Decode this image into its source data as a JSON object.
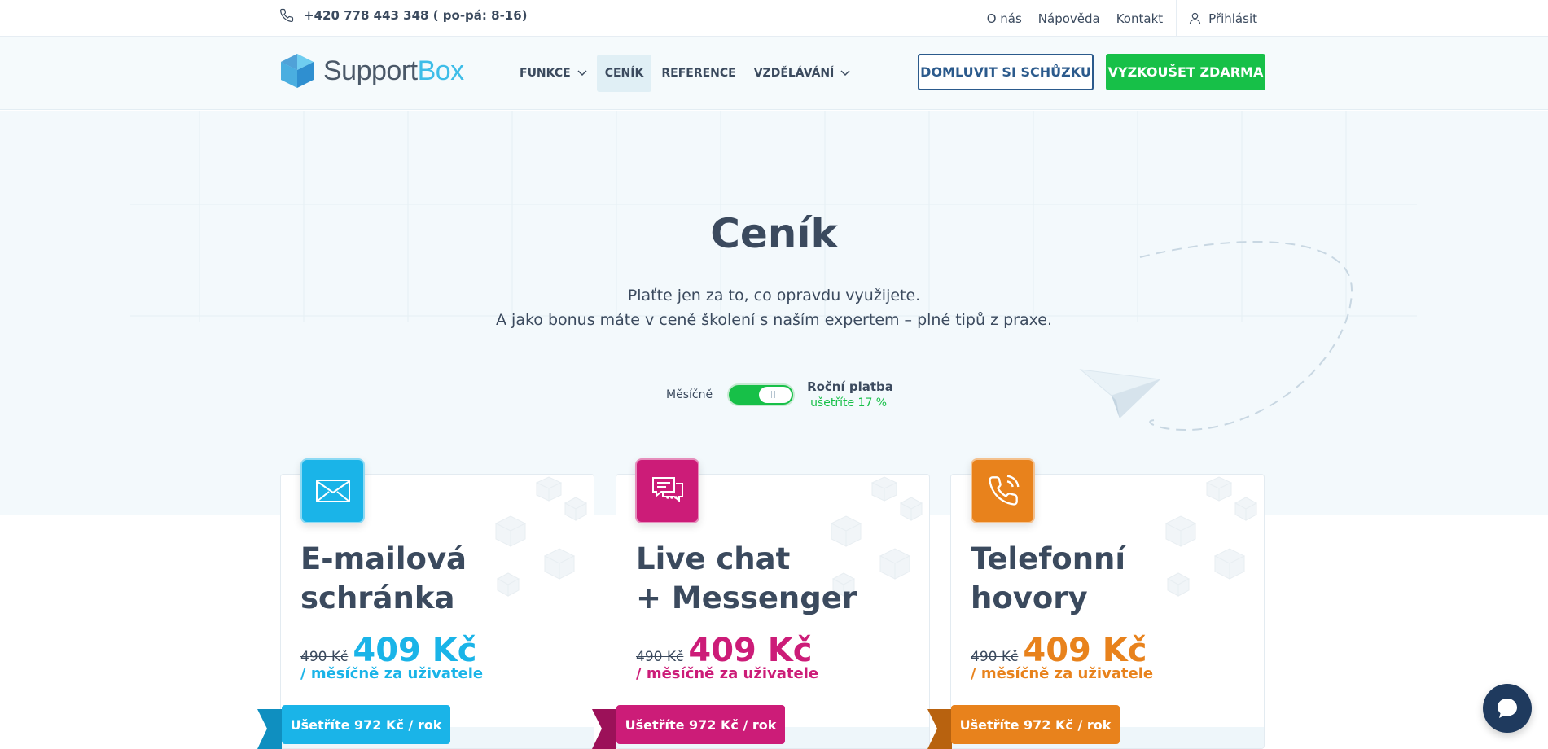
{
  "topbar": {
    "phone": "+420 778 443 348 ( po-pá: 8-16)",
    "links": [
      "O nás",
      "Nápověda",
      "Kontakt"
    ],
    "login": "Přihlásit"
  },
  "header": {
    "logo_support": "Support",
    "logo_box": "Box",
    "nav": [
      {
        "label": "FUNKCE",
        "dropdown": true
      },
      {
        "label": "CENÍK",
        "dropdown": false,
        "active": true
      },
      {
        "label": "REFERENCE",
        "dropdown": false
      },
      {
        "label": "VZDĚLÁVÁNÍ",
        "dropdown": true
      }
    ],
    "meeting_button": "DOMLUVIT SI SCHŮZKU",
    "trial_button": "VYZKOUŠET ZDARMA"
  },
  "hero": {
    "title": "Ceník",
    "subtitle_line1": "Plaťte jen za to, co opravdu využijete.",
    "subtitle_line2": "A jako bonus máte v ceně školení s naším expertem – plné tipů z praxe.",
    "toggle_monthly": "Měsíčně",
    "toggle_yearly": "Roční platba",
    "yearly_saving": "ušetříte 17 %",
    "toggle_state": "yearly"
  },
  "plans": [
    {
      "title_line1": "E-mailová",
      "title_line2": "schránka",
      "old_price": "490 Kč",
      "new_price": "409 Kč",
      "per": "/ měsíčně za uživatele",
      "save": "Ušetříte 972 Kč / rok",
      "color": "#1ab4e8",
      "ribbon_color": "#0f8fc0",
      "icon": "envelope-icon"
    },
    {
      "title_line1": "Live chat",
      "title_line2": "+ Messenger",
      "old_price": "490 Kč",
      "new_price": "409 Kč",
      "per": "/ měsíčně za uživatele",
      "save": "Ušetříte 972 Kč / rok",
      "color": "#cc1c78",
      "ribbon_color": "#9c1159",
      "icon": "chat-bubbles-icon"
    },
    {
      "title_line1": "Telefonní",
      "title_line2": "hovory",
      "old_price": "490 Kč",
      "new_price": "409 Kč",
      "per": "/ měsíčně za uživatele",
      "save": "Ušetříte 972 Kč / rok",
      "color": "#e8821c",
      "ribbon_color": "#b8620f",
      "icon": "phone-ringing-icon"
    }
  ],
  "colors": {
    "accent_green": "#17c048",
    "brand_dark": "#2b5a8c",
    "text": "#3b4a5e"
  }
}
